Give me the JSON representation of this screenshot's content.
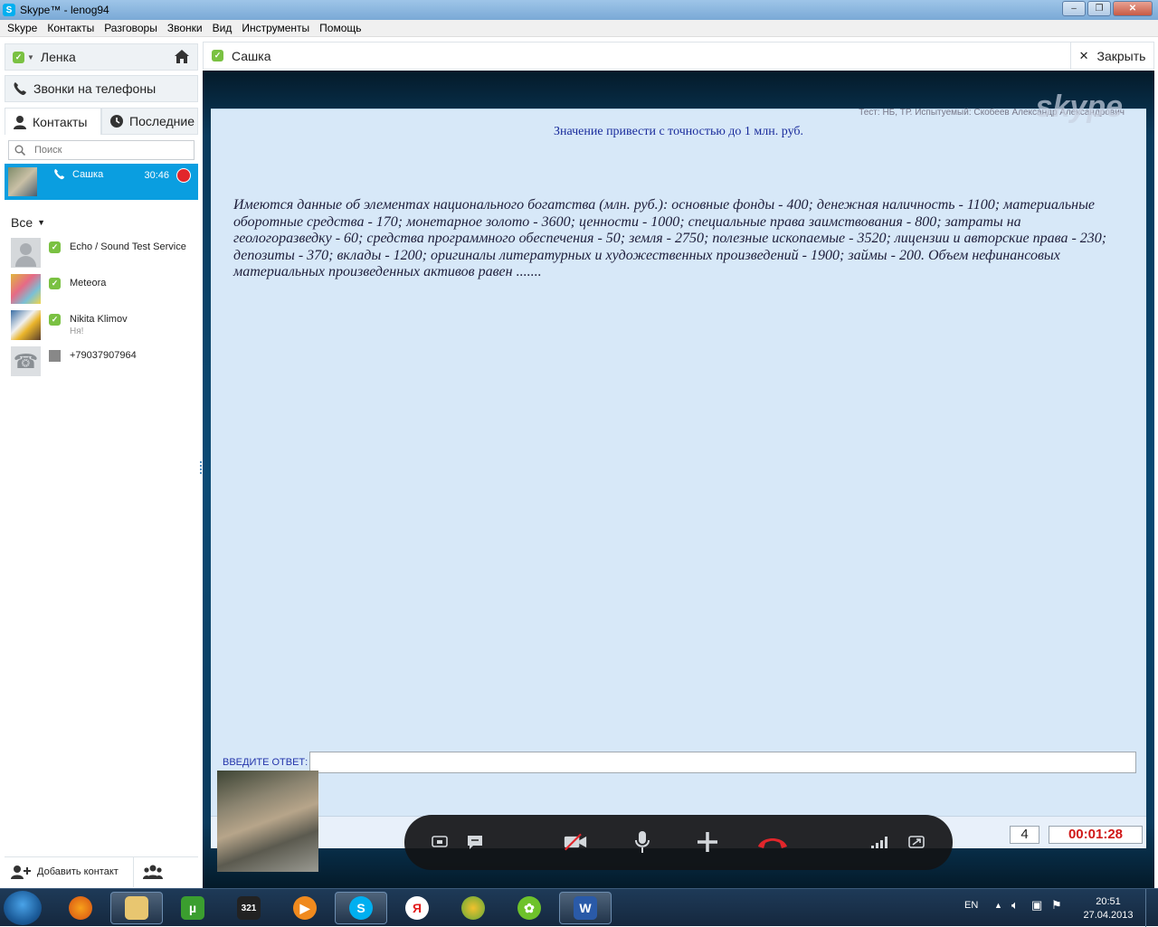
{
  "window": {
    "title": "Skype™ - lenog94",
    "minimize": "–",
    "maximize": "❐",
    "close": "✕"
  },
  "menu": [
    "Skype",
    "Контакты",
    "Разговоры",
    "Звонки",
    "Вид",
    "Инструменты",
    "Помощь"
  ],
  "sidebar": {
    "user_name": "Ленка",
    "phone_calls": "Звонки на телефоны",
    "tab_contacts": "Контакты",
    "tab_recent": "Последние",
    "search_placeholder": "Поиск",
    "active_contact": {
      "name": "Сашка",
      "call_time": "30:46"
    },
    "filter_label": "Все",
    "contacts": [
      {
        "name": "Echo / Sound Test Service",
        "mood": ""
      },
      {
        "name": "Meteora",
        "mood": ""
      },
      {
        "name": "Nikita Klimov",
        "mood": "Ня!"
      },
      {
        "name": "+79037907964",
        "mood": ""
      }
    ],
    "add_contact": "Добавить контакт"
  },
  "conversation": {
    "contact_name": "Сашка",
    "close_label": "Закрыть"
  },
  "shared_screen": {
    "credits": "Тест: НБ, ТР. Испытуемый: Скобеев Александр Александрович",
    "watermark": "skype",
    "heading": "Значение привести с точностью до 1 млн. руб.",
    "question": "Имеются данные об элементах национального богатства (млн. руб.): основные фонды - 400; денежная наличность - 1100; материальные оборотные средства - 170; монетарное золото - 3600; ценности - 1000; специальные права заимствования - 800; затраты на геологоразведку - 60; средства программного обеспечения - 50; земля - 2750; полезные ископаемые - 3520; лицензии и авторские права - 230; депозиты - 370; вклады - 1200; оригиналы литературных и художественных произведений - 1900; займы - 200. Объем нефинансовых материальных произведенных активов равен .......",
    "answer_label": "ВВЕДИТЕ ОТВЕТ:",
    "answer_value": "",
    "counter": "4",
    "timer": "00:01:28"
  },
  "taskbar": {
    "lang": "EN",
    "time": "20:51",
    "date": "27.04.2013"
  },
  "colors": {
    "skype_blue": "#00aff0",
    "online_green": "#7ac142",
    "hangup_red": "#e2262b",
    "timer_red": "#d01717"
  }
}
